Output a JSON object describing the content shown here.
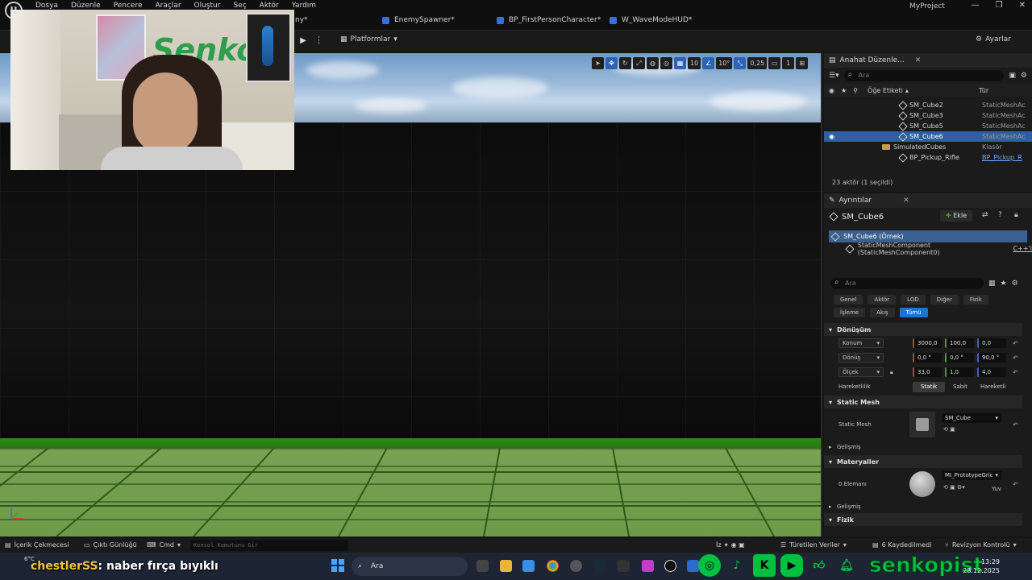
{
  "menu": [
    "Dosya",
    "Düzenle",
    "Pencere",
    "Araçlar",
    "Oluştur",
    "Seç",
    "Aktör",
    "Yardım"
  ],
  "project_name": "MyProject",
  "window_controls": [
    "—",
    "❐",
    "✕"
  ],
  "tabs": [
    {
      "label": "ny*",
      "color": "#888888"
    },
    {
      "label": "EnemySpawner*",
      "color": "#3a6fd8"
    },
    {
      "label": "BP_FirstPersonCharacter*",
      "color": "#3a6fd8"
    },
    {
      "label": "W_WaveModeHUD*",
      "color": "#3a6fd8"
    }
  ],
  "toolbar": {
    "platforms_label": "Platformlar",
    "settings_label": "Ayarlar"
  },
  "viewport_toolbar": {
    "grid_snap": "10",
    "rotation_snap": "10°",
    "scale_snap": "0,25",
    "camera_speed": "1"
  },
  "outliner": {
    "tab_label": "Anahat Düzenle...",
    "search_placeholder": "Ara",
    "col_label": "Öğe Etiketi",
    "col_type": "Tür",
    "rows": [
      {
        "name": "SM_Cube2",
        "type": "StaticMeshAc",
        "icon": "mesh",
        "selected": false
      },
      {
        "name": "SM_Cube3",
        "type": "StaticMeshAc",
        "icon": "mesh",
        "selected": false
      },
      {
        "name": "SM_Cube5",
        "type": "StaticMeshAc",
        "icon": "mesh",
        "selected": false
      },
      {
        "name": "SM_Cube6",
        "type": "StaticMeshAc",
        "icon": "mesh",
        "selected": true
      },
      {
        "name": "SimulatedCubes",
        "type": "Klasör",
        "icon": "folder",
        "selected": false
      },
      {
        "name": "BP_Pickup_Rifle",
        "type": "BP_Pickup_R",
        "icon": "mesh",
        "selected": false
      }
    ],
    "actor_count": "23 aktör (1 seçildi)"
  },
  "details": {
    "tab_label": "Ayrıntılar",
    "actor_name": "SM_Cube6",
    "add_label": "Ekle",
    "instance_row": "SM_Cube6 (Örnek)",
    "component_row": "StaticMeshComponent (StaticMeshComponent0)",
    "component_link": "C++'i",
    "search_placeholder": "Ara",
    "filters_row1": [
      "Genel",
      "Aktör",
      "LOD",
      "Diğer",
      "Fizik"
    ],
    "filters_row2": [
      "İşleme",
      "Akış",
      "Tümü"
    ],
    "active_filter": "Tümü",
    "transform_section": "Dönüşüm",
    "location_label": "Konum",
    "location": [
      "3000,0",
      "100,0",
      "0,0"
    ],
    "rotation_label": "Dönüş",
    "rotation": [
      "0,0 °",
      "0,0 °",
      "90,0 °"
    ],
    "scale_label": "Ölçek",
    "scale": [
      "33,0",
      "1,0",
      "4,0"
    ],
    "mobility_label": "Hareketlilik",
    "mobility_options": [
      "Statik",
      "Sabit",
      "Hareketli"
    ],
    "mobility_selected": "Statik",
    "static_mesh_section": "Static Mesh",
    "static_mesh_label": "Static Mesh",
    "static_mesh_value": "SM_Cube",
    "advanced_label": "Gelişmiş",
    "materials_section": "Materyaller",
    "materials_label": "0 Elemanı",
    "material_value": "MI_PrototypeGric",
    "material_extra": "Yuv",
    "advanced_label2": "Gelişmiş",
    "physics_section": "Fizik"
  },
  "statusbar": {
    "content_drawer": "İçerik Çekmecesi",
    "output_log": "Çıktı Günlüğü",
    "cmd": "Cmd",
    "cmd_placeholder": "Konsol Komutunu Gir",
    "trace": "İz",
    "derived_data": "Türetilen Veriler",
    "saved": "6 Kaydedilmedi",
    "revision": "Revizyon Kontrolü"
  },
  "taskbar": {
    "weather_temp": "6°C",
    "chat_user": "chestlerSS",
    "chat_text": ": naber fırça bıyıklı",
    "search_label": "Ara",
    "brand": "senkopist",
    "time": "13:29",
    "date": "28.12.2025"
  }
}
